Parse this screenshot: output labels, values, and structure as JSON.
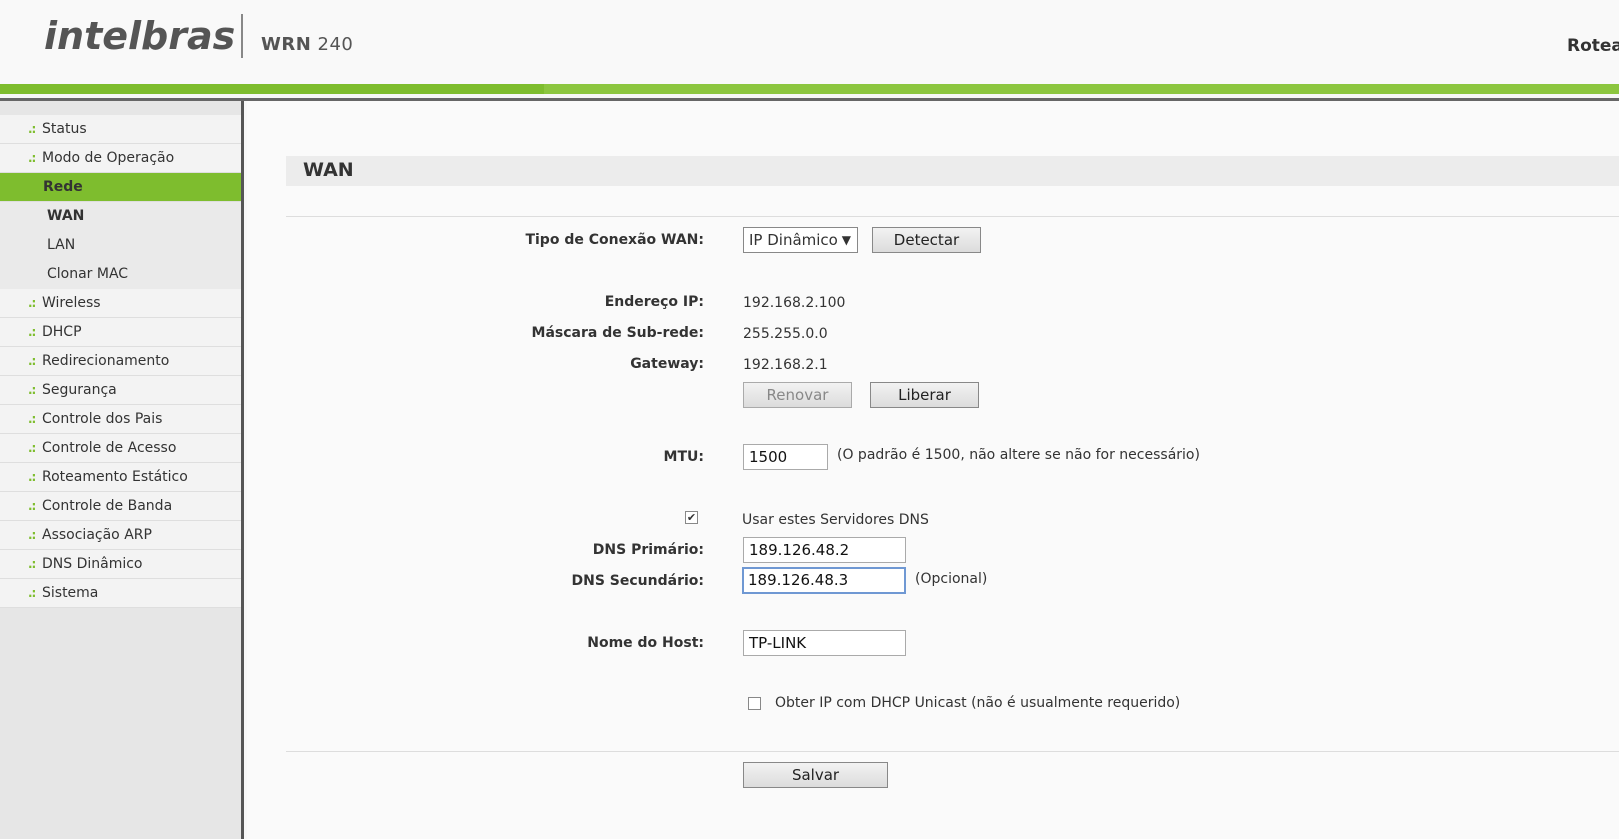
{
  "header": {
    "brand": "intelbras",
    "model_prefix": "WRN",
    "model_number": "240",
    "right_text": "Roteador"
  },
  "sidebar": {
    "items": [
      {
        "label": "Status"
      },
      {
        "label": "Modo de Operação"
      },
      {
        "label": "Rede"
      },
      {
        "label": "WAN"
      },
      {
        "label": "LAN"
      },
      {
        "label": "Clonar MAC"
      },
      {
        "label": "Wireless"
      },
      {
        "label": "DHCP"
      },
      {
        "label": "Redirecionamento"
      },
      {
        "label": "Segurança"
      },
      {
        "label": "Controle dos Pais"
      },
      {
        "label": "Controle de Acesso"
      },
      {
        "label": "Roteamento Estático"
      },
      {
        "label": "Controle de Banda"
      },
      {
        "label": "Associação ARP"
      },
      {
        "label": "DNS Dinâmico"
      },
      {
        "label": "Sistema"
      }
    ],
    "bullet": ".:"
  },
  "main": {
    "title": "WAN",
    "conn_type_label": "Tipo de Conexão WAN:",
    "conn_type_value": "IP Dinâmico",
    "detect_button": "Detectar",
    "ip_label": "Endereço IP:",
    "ip_value": "192.168.2.100",
    "mask_label": "Máscara de Sub-rede:",
    "mask_value": "255.255.0.0",
    "gateway_label": "Gateway:",
    "gateway_value": "192.168.2.1",
    "renew_button": "Renovar",
    "release_button": "Liberar",
    "mtu_label": "MTU:",
    "mtu_value": "1500",
    "mtu_note": "(O padrão é 1500, não altere se não for necessário)",
    "use_dns_label": "Usar estes Servidores DNS",
    "use_dns_checked": true,
    "dns1_label": "DNS Primário:",
    "dns1_value": "189.126.48.2",
    "dns2_label": "DNS Secundário:",
    "dns2_value": "189.126.48.3",
    "dns2_note": "(Opcional)",
    "host_label": "Nome do Host:",
    "host_value": "TP-LINK",
    "unicast_label": "Obter IP com DHCP Unicast (não é usualmente requerido)",
    "unicast_checked": false,
    "save_button": "Salvar"
  },
  "colors": {
    "accent_green": "#7ebd2e",
    "focus_blue": "#6f98d3"
  }
}
